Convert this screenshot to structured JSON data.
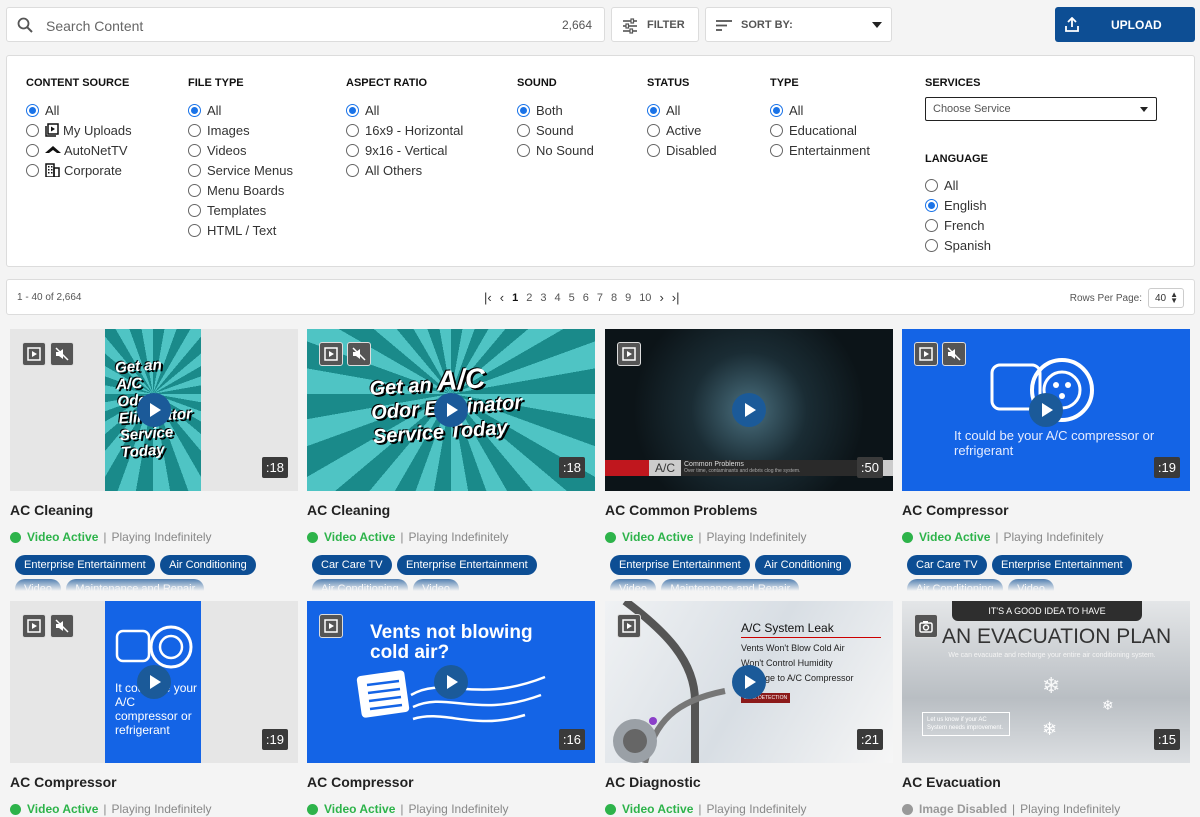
{
  "search": {
    "placeholder": "Search Content",
    "count": "2,664"
  },
  "toolbar": {
    "filter_label": "FILTER",
    "sort_label": "SORT BY:",
    "upload_label": "UPLOAD"
  },
  "filters": {
    "content_source": {
      "title": "CONTENT SOURCE",
      "options": [
        "All",
        "My Uploads",
        "AutoNetTV",
        "Corporate"
      ],
      "selected": "All"
    },
    "file_type": {
      "title": "FILE TYPE",
      "options": [
        "All",
        "Images",
        "Videos",
        "Service Menus",
        "Menu Boards",
        "Templates",
        "HTML / Text"
      ],
      "selected": "All"
    },
    "aspect_ratio": {
      "title": "ASPECT RATIO",
      "options": [
        "All",
        "16x9 - Horizontal",
        "9x16 - Vertical",
        "All Others"
      ],
      "selected": "All"
    },
    "sound": {
      "title": "SOUND",
      "options": [
        "Both",
        "Sound",
        "No Sound"
      ],
      "selected": "Both"
    },
    "status": {
      "title": "STATUS",
      "options": [
        "All",
        "Active",
        "Disabled"
      ],
      "selected": "All"
    },
    "type": {
      "title": "TYPE",
      "options": [
        "All",
        "Educational",
        "Entertainment"
      ],
      "selected": "All"
    },
    "services": {
      "title": "SERVICES",
      "placeholder": "Choose Service"
    },
    "language": {
      "title": "LANGUAGE",
      "options": [
        "All",
        "English",
        "French",
        "Spanish"
      ],
      "selected": "English"
    }
  },
  "pager": {
    "range": "1 - 40 of 2,664",
    "pages": [
      "1",
      "2",
      "3",
      "4",
      "5",
      "6",
      "7",
      "8",
      "9",
      "10"
    ],
    "current": "1",
    "rows_label": "Rows Per Page:",
    "rows_value": "40"
  },
  "thumb_text": {
    "odor_lines": [
      "Get an",
      "A/C",
      "Odor Eliminator",
      "Service Today"
    ],
    "odor_portrait_lines": [
      "Get an",
      "A/C",
      "Odor",
      "Eliminator",
      "Service",
      "Today"
    ],
    "compressor": "It could be your A/C compressor or refrigerant",
    "vents": "Vents not blowing cold air?",
    "leak_title": "A/C System Leak",
    "leak_lines": [
      "Vents Won't Blow Cold Air",
      "Won't Control Humidity",
      "Damage to A/C Compressor"
    ],
    "leak_badge": "LEAK DETECTION",
    "evac_top": "IT'S A GOOD IDEA TO HAVE",
    "evac_main": "AN EVACUATION PLAN",
    "evac_sub": "We can evacuate and recharge your entire air conditioning system.",
    "evac_box": "Let us know if your AC System needs improvement.",
    "problems_tag": "A/C",
    "problems_title": "Common Problems",
    "problems_sub": "Over time, contaminants and debris clog the system."
  },
  "cards": [
    {
      "title": "AC Cleaning",
      "duration": ":18",
      "status": "Video Active",
      "playing": "Playing Indefinitely",
      "tags": [
        "Enterprise Entertainment",
        "Air Conditioning",
        "Video",
        "Maintenance and Repair"
      ],
      "sound": "muted"
    },
    {
      "title": "AC Cleaning",
      "duration": ":18",
      "status": "Video Active",
      "playing": "Playing Indefinitely",
      "tags": [
        "Car Care TV",
        "Enterprise Entertainment",
        "Air Conditioning",
        "Video"
      ],
      "sound": "muted"
    },
    {
      "title": "AC Common Problems",
      "duration": ":50",
      "status": "Video Active",
      "playing": "Playing Indefinitely",
      "tags": [
        "Enterprise Entertainment",
        "Air Conditioning",
        "Video",
        "Maintenance and Repair"
      ],
      "sound": "on"
    },
    {
      "title": "AC Compressor",
      "duration": ":19",
      "status": "Video Active",
      "playing": "Playing Indefinitely",
      "tags": [
        "Car Care TV",
        "Enterprise Entertainment",
        "Air Conditioning",
        "Video"
      ],
      "sound": "muted"
    },
    {
      "title": "AC Compressor",
      "duration": ":19",
      "status": "Video Active",
      "playing": "Playing Indefinitely",
      "tags": [],
      "sound": "muted"
    },
    {
      "title": "AC Compressor",
      "duration": ":16",
      "status": "Video Active",
      "playing": "Playing Indefinitely",
      "tags": [],
      "sound": "on"
    },
    {
      "title": "AC Diagnostic",
      "duration": ":21",
      "status": "Video Active",
      "playing": "Playing Indefinitely",
      "tags": [],
      "sound": "on"
    },
    {
      "title": "AC Evacuation",
      "duration": ":15",
      "status": "Image Disabled",
      "playing": "Playing Indefinitely",
      "tags": [],
      "sound": "none"
    }
  ],
  "colors": {
    "accent": "#0d4e94",
    "active": "#2db34a",
    "disabled": "#999999",
    "radio": "#1a73e8"
  }
}
